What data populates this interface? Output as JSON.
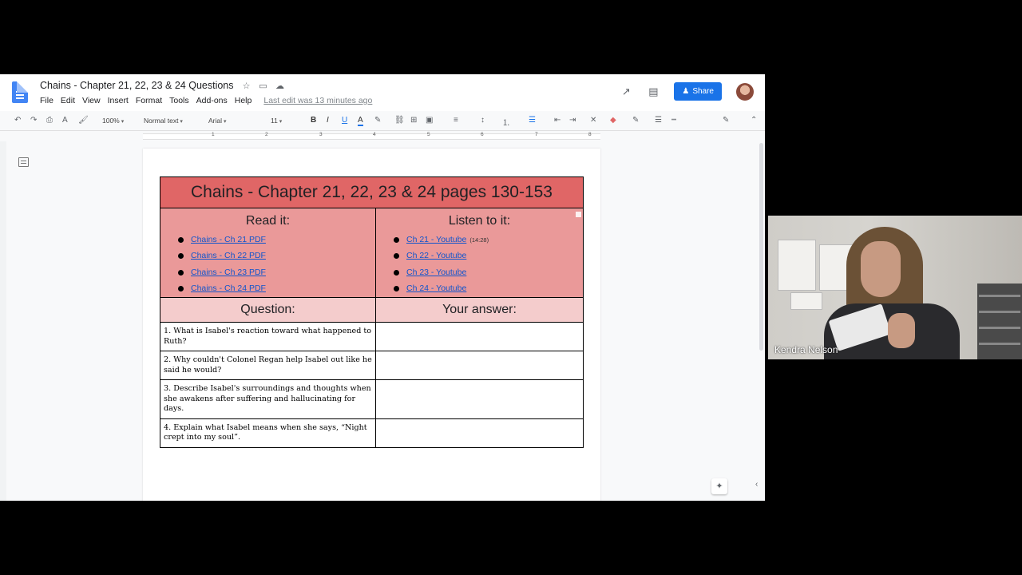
{
  "doc": {
    "title": "Chains - Chapter 21, 22, 23 & 24 Questions",
    "menu": [
      "File",
      "Edit",
      "View",
      "Insert",
      "Format",
      "Tools",
      "Add-ons",
      "Help"
    ],
    "last_edit": "Last edit was 13 minutes ago",
    "share_label": "Share"
  },
  "toolbar": {
    "zoom": "100%",
    "style": "Normal text",
    "font": "Arial",
    "font_size": "11"
  },
  "ruler": {
    "numbers": [
      "1",
      "2",
      "3",
      "4",
      "5",
      "6",
      "7",
      "8"
    ]
  },
  "table": {
    "title": "Chains - Chapter 21, 22, 23 & 24 pages 130-153",
    "read_heading": "Read it:",
    "listen_heading": "Listen to it:",
    "read_links": [
      "Chains - Ch 21 PDF",
      "Chains - Ch 22 PDF",
      "Chains - Ch 23 PDF",
      "Chains - Ch 24 PDF"
    ],
    "listen_links": [
      "Ch 21 - Youtube",
      "Ch 22 - Youtube",
      "Ch 23 - Youtube",
      "Ch 24 - Youtube"
    ],
    "listen_duration": "(14:28)",
    "question_heading": "Question:",
    "answer_heading": "Your answer:",
    "questions": [
      "1. What is Isabel's reaction toward what happened to Ruth?",
      "2. Why couldn't Colonel Regan help Isabel out like he said he would?",
      "3. Describe Isabel's surroundings and thoughts when she awakens after suffering and hallucinating for days.",
      "4. Explain what Isabel means when she says, “Night crept into my soul”."
    ]
  },
  "video": {
    "participant_name": "Kendra Nelson"
  },
  "colors": {
    "title_row": "#e06666",
    "sub_row": "#ea9999",
    "head_row": "#f4cccc",
    "share": "#1a73e8"
  }
}
